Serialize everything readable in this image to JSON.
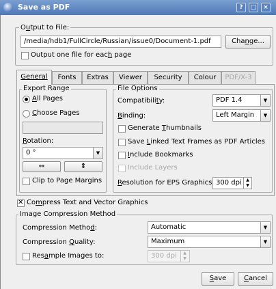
{
  "window": {
    "title": "Save as PDF",
    "help_btn": "?",
    "max_btn": "□",
    "close_btn": "×"
  },
  "output": {
    "legend": "Output to File:",
    "path": "/media/hdb1/FullCircle/Russian/issue0/Document-1.pdf",
    "change_label": "Change...",
    "one_file_label": "Output one file for each page",
    "one_file_checked": false
  },
  "tabs": [
    {
      "label": "General",
      "active": true,
      "enabled": true
    },
    {
      "label": "Fonts",
      "active": false,
      "enabled": true
    },
    {
      "label": "Extras",
      "active": false,
      "enabled": true
    },
    {
      "label": "Viewer",
      "active": false,
      "enabled": true
    },
    {
      "label": "Security",
      "active": false,
      "enabled": true
    },
    {
      "label": "Colour",
      "active": false,
      "enabled": true
    },
    {
      "label": "PDF/X-3",
      "active": false,
      "enabled": false
    }
  ],
  "export_range": {
    "legend": "Export Range",
    "all_pages": "All Pages",
    "choose_pages": "Choose Pages",
    "pages_value": "",
    "rotation_label": "Rotation:",
    "rotation_value": "0 °",
    "flip_h_icon": "⇿",
    "flip_v_icon": "⇕",
    "clip_label": "Clip to Page Margins"
  },
  "file_options": {
    "legend": "File Options",
    "compat_label": "Compatibility:",
    "compat_value": "PDF 1.4",
    "binding_label": "Binding:",
    "binding_value": "Left Margin",
    "thumbnails": "Generate Thumbnails",
    "linked_frames": "Save Linked Text Frames as PDF Articles",
    "bookmarks": "Include Bookmarks",
    "layers": "Include Layers",
    "eps_res_label": "Resolution for EPS Graphics:",
    "eps_res_value": "300 dpi"
  },
  "compress_text": {
    "label": "Compress Text and Vector Graphics",
    "checked": true
  },
  "image_compression": {
    "legend": "Image Compression Method",
    "method_label": "Compression Method:",
    "method_value": "Automatic",
    "quality_label": "Compression Quality:",
    "quality_value": "Maximum",
    "resample_label": "Resample Images to:",
    "resample_value": "300 dpi"
  },
  "footer": {
    "save": "Save",
    "cancel": "Cancel"
  }
}
